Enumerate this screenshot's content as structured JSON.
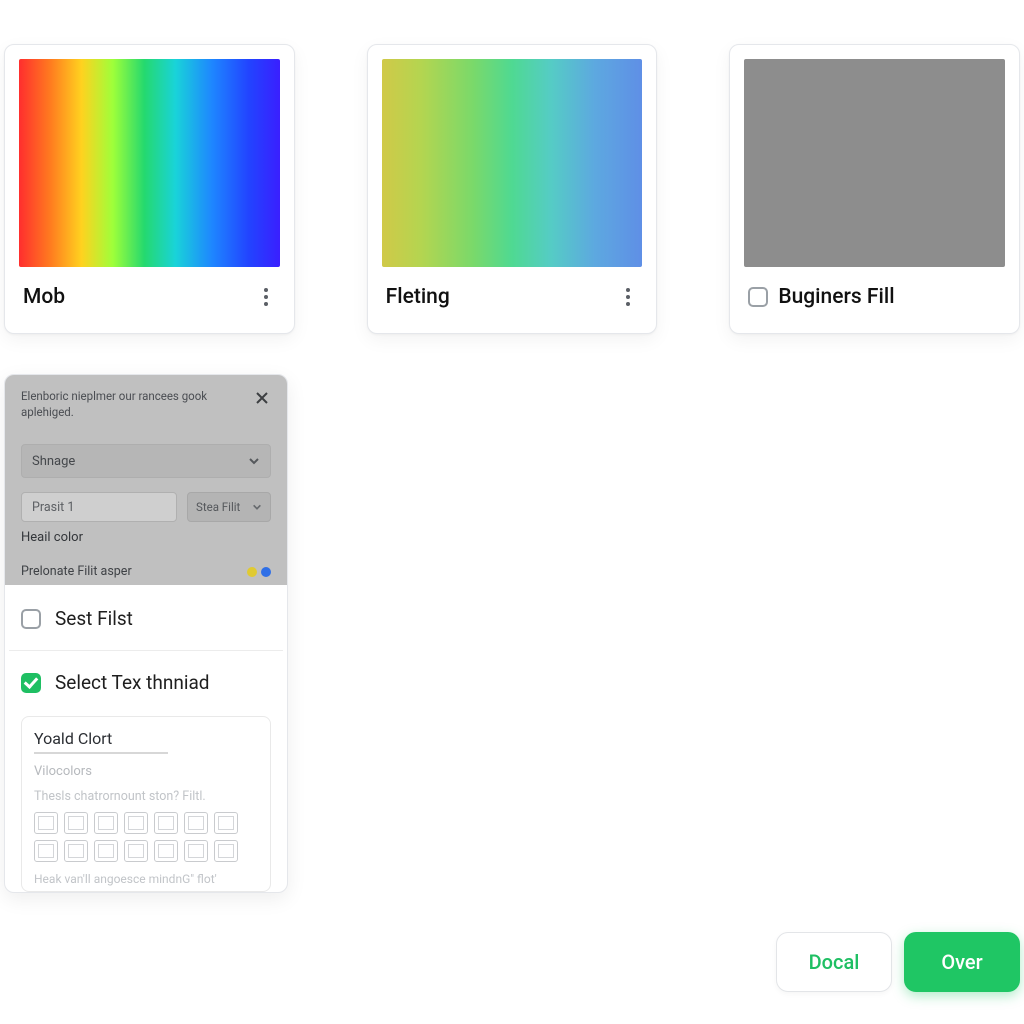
{
  "cards": [
    {
      "label": "Mob"
    },
    {
      "label": "Fleting"
    },
    {
      "label": "Buginers Fill",
      "has_checkbox": true
    }
  ],
  "panel": {
    "embed": {
      "hint": "Elenboric nieplmer our rancees gook aplehiged.",
      "dropdown": "Shnage",
      "preset_field": "Prasit 1",
      "preset_button": "Stea Filit",
      "heal_label": "Heail color",
      "foot_label": "Prelonate Filit asper"
    },
    "option1": "Sest Filst",
    "option2": "Select Tex thnniad",
    "sub": {
      "title": "Yoald Clort",
      "subtitle": "Vilocolors",
      "line2": "Thesls chatrornount ston? Filtl.",
      "foot": "Heak van'll angoesce mindnG\" flot'"
    }
  },
  "actions": {
    "secondary": "Docal",
    "primary": "Over"
  },
  "colors": {
    "accent": "#1fc664"
  }
}
